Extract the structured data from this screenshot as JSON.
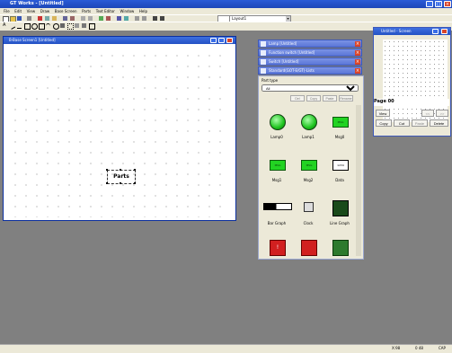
{
  "app": {
    "title": "GT Works - [Untitled]"
  },
  "menu": [
    "File",
    "Edit",
    "View",
    "Draw",
    "Base Screen",
    "Parts",
    "Text Editor",
    "Window",
    "Help"
  ],
  "toolbar": {
    "layer_value": "",
    "layer_select": "Layout1"
  },
  "draw_window": {
    "title": "B-Base Screen1 [Untitled]",
    "object_label": "Parts"
  },
  "panels": [
    {
      "title": "Lamp [Untitled]"
    },
    {
      "title": "Function switch [Untitled]"
    },
    {
      "title": "Switch [Untitled]"
    },
    {
      "title": "Standard(GOT-E/GT)-Lists"
    }
  ],
  "parts_panel": {
    "type_label": "Part type",
    "type_value": "All",
    "buttons": [
      "Del",
      "Copy",
      "Paste",
      "Rename"
    ],
    "items": [
      {
        "name": "Lamp0",
        "icon": "lamp-icon"
      },
      {
        "name": "Lamp1",
        "icon": "lamp-icon"
      },
      {
        "name": "Msg0",
        "icon": "message-icon",
        "text": "MSG"
      },
      {
        "name": "Msg1",
        "icon": "message-icon",
        "text": "MSG"
      },
      {
        "name": "Msg2",
        "icon": "message-icon",
        "text": "MSG"
      },
      {
        "name": "Data",
        "icon": "data-display-icon",
        "text": "1234"
      },
      {
        "name": "Bar Graph",
        "icon": "bar-graph-icon"
      },
      {
        "name": "Clock",
        "icon": "clock-icon"
      },
      {
        "name": "Line Graph",
        "icon": "line-graph-icon"
      },
      {
        "name": "",
        "icon": "alarm-icon"
      },
      {
        "name": "",
        "icon": "switch-icon"
      },
      {
        "name": "",
        "icon": "keypad-icon"
      }
    ]
  },
  "page_window": {
    "title": "Untitled - Screen",
    "page_label": "Page 00",
    "buttons": [
      "View",
      "<<",
      ">>",
      "Copy",
      "Cut",
      "Paste",
      "Delete"
    ]
  },
  "status": {
    "pos": "X:98",
    "size": "0   48",
    "mode": "CAP"
  }
}
